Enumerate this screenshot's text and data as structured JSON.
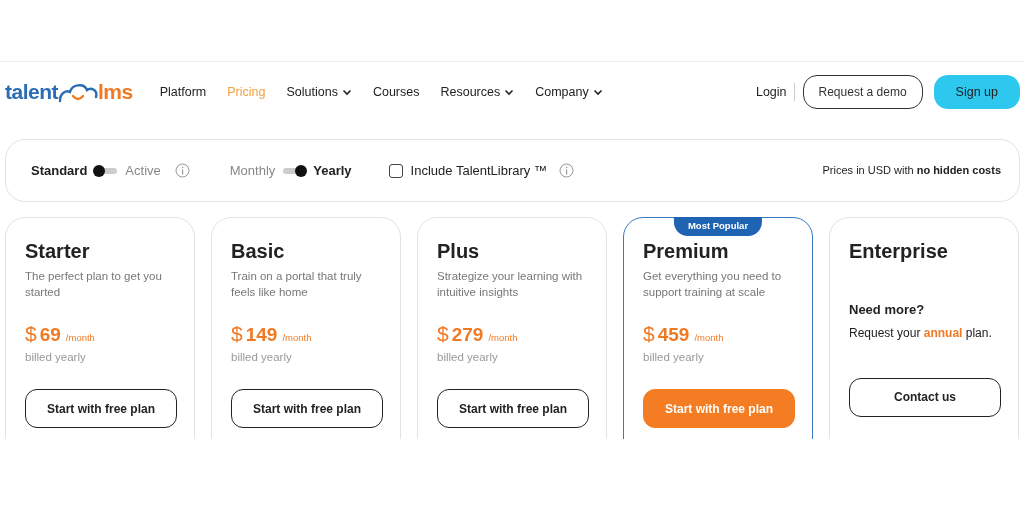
{
  "header": {
    "logo": {
      "left": "talent",
      "right": "lms"
    },
    "nav": [
      {
        "label": "Platform",
        "selected": false,
        "has_menu": false
      },
      {
        "label": "Pricing",
        "selected": true,
        "has_menu": false
      },
      {
        "label": "Solutions",
        "selected": false,
        "has_menu": true
      },
      {
        "label": "Courses",
        "selected": false,
        "has_menu": false
      },
      {
        "label": "Resources",
        "selected": false,
        "has_menu": true
      },
      {
        "label": "Company",
        "selected": false,
        "has_menu": true
      }
    ],
    "login": "Login",
    "demo_button": "Request a demo",
    "signup_button": "Sign up"
  },
  "filters": {
    "toggles": [
      {
        "left": "Standard",
        "right": "Active",
        "on": false,
        "info": true
      },
      {
        "left": "Monthly",
        "right": "Yearly",
        "on": true,
        "info": false
      }
    ],
    "library": {
      "label": "Include TalentLibrary ™",
      "checked": false
    },
    "note": "Prices in USD with **no hidden costs**"
  },
  "plans": [
    {
      "kind": "plan",
      "name": "Starter",
      "featured": false,
      "description": "The perfect plan to get you started",
      "currency": "$",
      "price": "69",
      "period": "/month",
      "billing": "billed yearly",
      "button": "Start with free plan"
    },
    {
      "kind": "plan",
      "name": "Basic",
      "featured": false,
      "description": "Train on a portal that truly feels like home",
      "currency": "$",
      "price": "149",
      "period": "/month",
      "billing": "billed yearly",
      "button": "Start with free plan"
    },
    {
      "kind": "plan",
      "name": "Plus",
      "featured": false,
      "description": "Strategize your learning with intuitive insights",
      "currency": "$",
      "price": "279",
      "period": "/month",
      "billing": "billed yearly",
      "button": "Start with free plan"
    },
    {
      "kind": "plan",
      "name": "Premium",
      "featured": true,
      "badge": "Most Popular",
      "description": "Get everything you need to support training at scale",
      "currency": "$",
      "price": "459",
      "period": "/month",
      "billing": "billed yearly",
      "button": "Start with free plan"
    },
    {
      "kind": "enterprise",
      "name": "Enterprise",
      "featured": false,
      "heading": "Need more?",
      "text": "Request your **annual** plan.",
      "button": "Contact us"
    }
  ]
}
